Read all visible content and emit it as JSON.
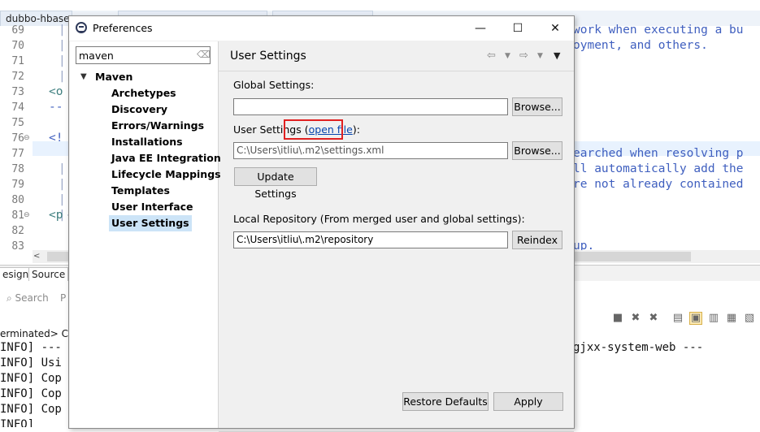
{
  "ide": {
    "tabs": [
      "dubbo-hbase",
      "",
      ""
    ],
    "line_numbers": [
      "69",
      "70",
      "71",
      "72",
      "73",
      "74",
      "75",
      "76",
      "77",
      "78",
      "79",
      "80",
      "81",
      "82",
      "83"
    ],
    "code_fragments": {
      "l69": "|",
      "l69r": "work when executing a bu",
      "l70": "|",
      "l70r": "oyment, and others.",
      "l71": "|",
      "l72": "|",
      "l73": "<o",
      "l74": "--",
      "l76": "<!",
      "l76r": "earched when resolving p",
      "l77": "|",
      "l77r": "ll automatically add the",
      "l78": "|",
      "l78r": "re not already contained",
      "l79": "|",
      "l80": "|-",
      "l81": "<p",
      "l83r": "up."
    },
    "scroll_left_arrow": "<",
    "bottom_tabs": {
      "design": "esign",
      "source": "Source"
    },
    "console_tabs": {
      "search": "Search",
      "p": "P"
    },
    "console_lines": [
      "erminated> C:\\",
      "INFO] ---",
      "INFO] Usi",
      "INFO] Cop",
      "INFO] Cop",
      "INFO] Cop",
      "INFO]"
    ],
    "console_right": "gjxx-system-web ---"
  },
  "dialog": {
    "title": "Preferences",
    "window_buttons": {
      "minimize": "—",
      "maximize": "☐",
      "close": "✕"
    },
    "filter": {
      "value": "maven"
    },
    "tree": {
      "root": "Maven",
      "items": [
        "Archetypes",
        "Discovery",
        "Errors/Warnings",
        "Installations",
        "Java EE Integration",
        "Lifecycle Mappings",
        "Templates",
        "User Interface",
        "User Settings"
      ],
      "selected_index": 8
    },
    "page": {
      "title": "User Settings",
      "global_settings_label": "Global Settings:",
      "global_settings_value": "",
      "browse_label": "Browse...",
      "user_settings_label": "User Settings ",
      "open_file_paren_open": "(",
      "open_file_link": "open file",
      "open_file_paren_close": "):",
      "user_settings_value": "C:\\Users\\itliu\\.m2\\settings.xml",
      "update_settings_label": "Update Settings",
      "local_repo_label": "Local Repository (From merged user and global settings):",
      "local_repo_value": "C:\\Users\\itliu\\.m2\\repository",
      "reindex_label": "Reindex",
      "restore_defaults_label": "Restore Defaults",
      "apply_label": "Apply"
    }
  },
  "colors": {
    "highlight": "#e02020",
    "selection": "#cce4f7",
    "link": "#0645ad"
  }
}
